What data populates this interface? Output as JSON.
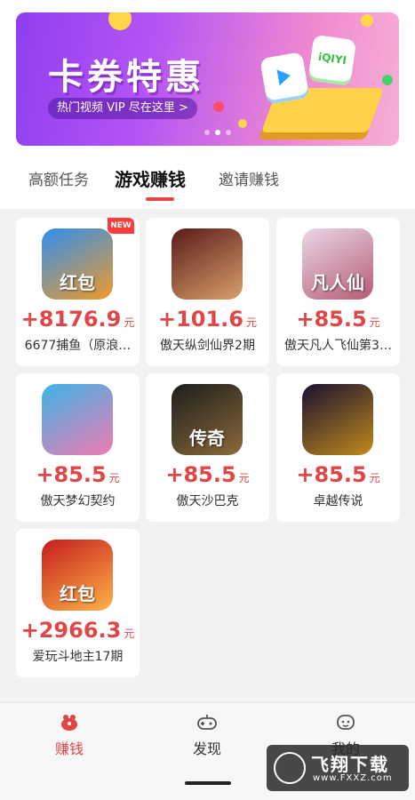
{
  "banner": {
    "title": "卡券特惠",
    "subtitle": "热门视频 VIP 尽在这里 >",
    "tile_text": "iQIYI",
    "page_count": 3,
    "active_page": 1
  },
  "tabs": [
    {
      "label": "高额任务",
      "active": false
    },
    {
      "label": "游戏赚钱",
      "active": true
    },
    {
      "label": "邀请赚钱",
      "active": false
    }
  ],
  "games": [
    {
      "reward": "+8176.9",
      "unit": "元",
      "name": "6677捕鱼（原浪…",
      "badge": "NEW",
      "icon": "fish-game-icon",
      "color1": "#2e8ff0",
      "color2": "#f09a2a",
      "glyph": "红包"
    },
    {
      "reward": "+101.6",
      "unit": "元",
      "name": "傲天纵剑仙界2期",
      "badge": "",
      "icon": "xianxia-heroine-icon",
      "color1": "#5b1a1a",
      "color2": "#d9a06a",
      "glyph": ""
    },
    {
      "reward": "+85.5",
      "unit": "元",
      "name": "傲天凡人飞仙第3…",
      "badge": "",
      "icon": "immortal-heroine-icon",
      "color1": "#e9d8e8",
      "color2": "#b65b74",
      "glyph": "凡人仙"
    },
    {
      "reward": "+85.5",
      "unit": "元",
      "name": "傲天梦幻契约",
      "badge": "",
      "icon": "anime-girl-icon",
      "color1": "#3bb5e8",
      "color2": "#f27ab1",
      "glyph": ""
    },
    {
      "reward": "+85.5",
      "unit": "元",
      "name": "傲天沙巴克",
      "badge": "",
      "icon": "legend-calligraphy-icon",
      "color1": "#1d1d1d",
      "color2": "#8a6a3a",
      "glyph": "传奇"
    },
    {
      "reward": "+85.5",
      "unit": "元",
      "name": "卓越传说",
      "badge": "",
      "icon": "dark-armor-icon",
      "color1": "#1a1030",
      "color2": "#c08a1c",
      "glyph": ""
    },
    {
      "reward": "+2966.3",
      "unit": "元",
      "name": "爱玩斗地主17期",
      "badge": "",
      "icon": "landlord-card-game-icon",
      "color1": "#c41d1d",
      "color2": "#ffb347",
      "glyph": "红包"
    }
  ],
  "nav": [
    {
      "label": "赚钱",
      "icon": "piggy-bank-icon",
      "active": true
    },
    {
      "label": "发现",
      "icon": "gamepad-icon",
      "active": false
    },
    {
      "label": "我的",
      "icon": "profile-face-icon",
      "active": false
    }
  ],
  "watermark": {
    "title": "飞翔下载",
    "url": "www.FXXZ.com"
  },
  "colors": {
    "accent": "#e04646",
    "card_bg": "#ffffff",
    "page_bg": "#f2f2f2"
  }
}
